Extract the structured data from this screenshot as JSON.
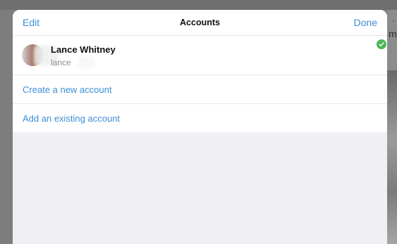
{
  "navbar": {
    "edit_label": "Edit",
    "title": "Accounts",
    "done_label": "Done"
  },
  "account": {
    "name": "Lance Whitney",
    "email": "lance",
    "selected": true
  },
  "actions": {
    "create": "Create a new account",
    "add": "Add an existing account"
  },
  "background": {
    "partial_text": "me"
  },
  "colors": {
    "accent": "#3d8ed6",
    "check": "#4cb85a",
    "sheet_bg": "#efeff4"
  }
}
